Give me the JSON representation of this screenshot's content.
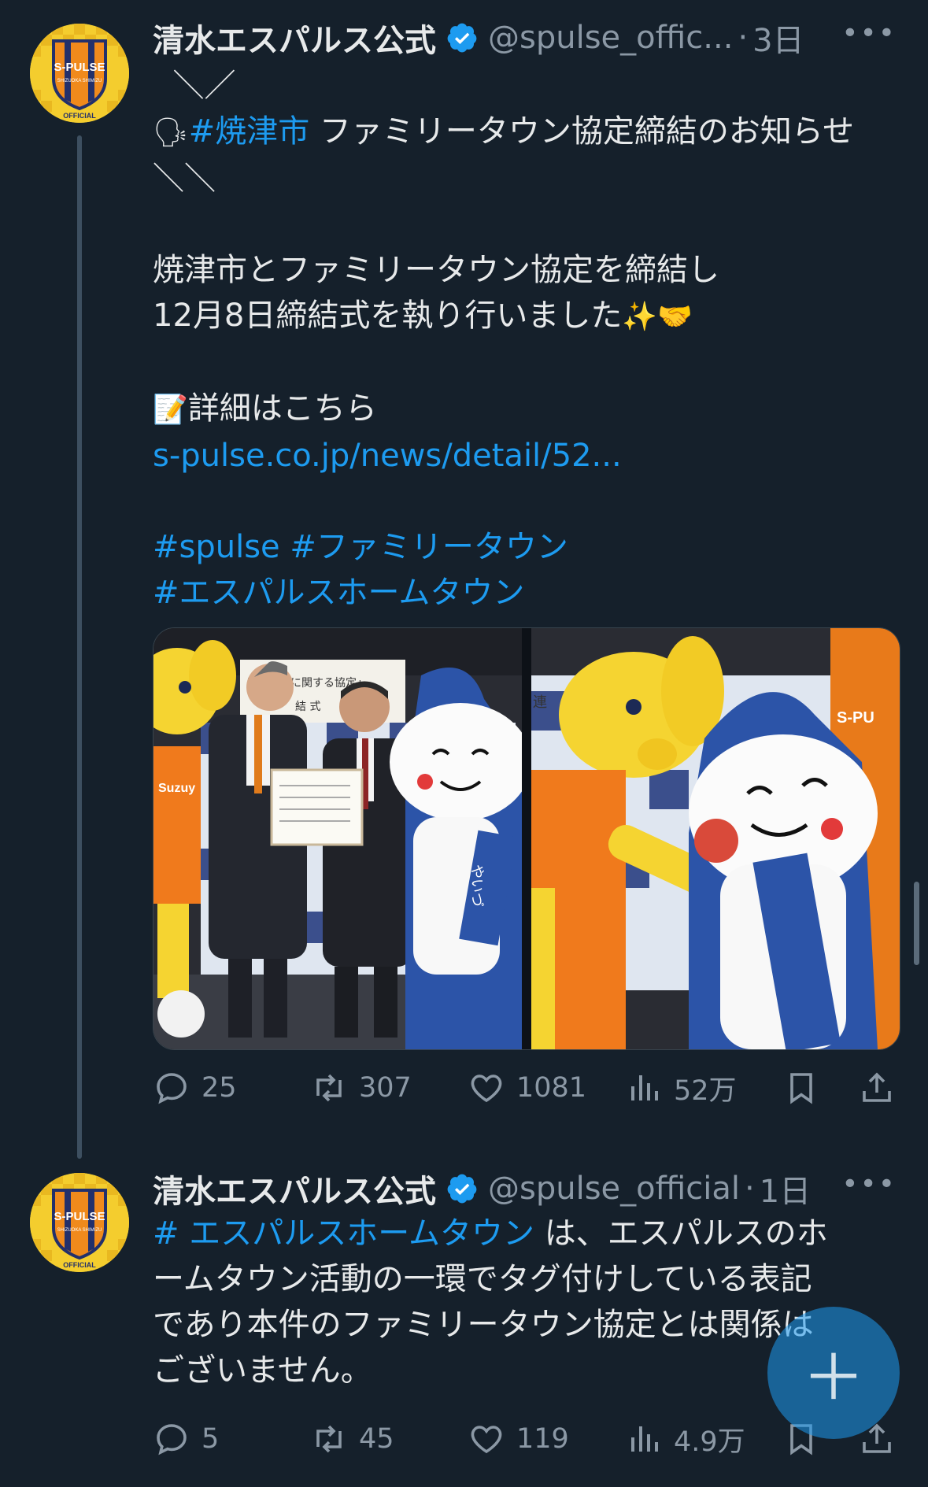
{
  "tweets": [
    {
      "author_name": "清水エスパルス公式",
      "handle": "@spulse_offic...",
      "time": "3日",
      "lines": {
        "l1": "＼／",
        "l2_emoji": "🗣",
        "l2_hashtag": "#焼津市",
        "l2_text": " ファミリータウン協定締結のお知らせ",
        "l3": "＼＼",
        "l4": "焼津市とファミリータウン協定を締結し",
        "l5_text": "12月8日締結式を執り行いました",
        "l5_emoji": "✨🤝",
        "l6_emoji": "📝",
        "l6_text": "詳細はこちら",
        "l7_link": "s-pulse.co.jp/news/detail/52...",
        "l8_tag1": "#spulse",
        "l8_tag2": "#ファミリータウン",
        "l9_tag": "#エスパルスホームタウン"
      },
      "stats": {
        "replies": "25",
        "retweets": "307",
        "likes": "1081",
        "views": "52万"
      }
    },
    {
      "author_name": "清水エスパルス公式",
      "handle": "@spulse_official",
      "time": "1日",
      "lines": {
        "l1_hashtag": "# エスパルスホームタウン",
        "l1_text": " は、エスパルスのホ",
        "l2": "ームタウン活動の一環でタグ付けしている表記",
        "l3": "であり本件のファミリータウン協定とは関係は",
        "l4": "ございません。"
      },
      "stats": {
        "replies": "5",
        "retweets": "45",
        "likes": "119",
        "views": "4.9万"
      }
    }
  ],
  "avatar": {
    "logo_text": "S-PULSE",
    "sub_text": "SHIZUOKA SHIMIZU",
    "badge_text": "OFFICIAL"
  },
  "media": {
    "photo1_sign_text": "けた連携に関する協定」",
    "photo1_sign_sub": "結 式",
    "photo1_shirt_text": "Suzuy",
    "photo2_sign_text": "連",
    "mascot_sash_text": "やいづ",
    "banner_text": "S-PU"
  },
  "icons": [
    "verified-badge-icon",
    "more-icon",
    "reply-icon",
    "retweet-icon",
    "like-icon",
    "views-icon",
    "bookmark-icon",
    "share-icon",
    "compose-icon"
  ],
  "colors": {
    "background": "#15202b",
    "link": "#1d9bf0",
    "muted": "#8b98a5",
    "text": "#e7e9ea"
  }
}
